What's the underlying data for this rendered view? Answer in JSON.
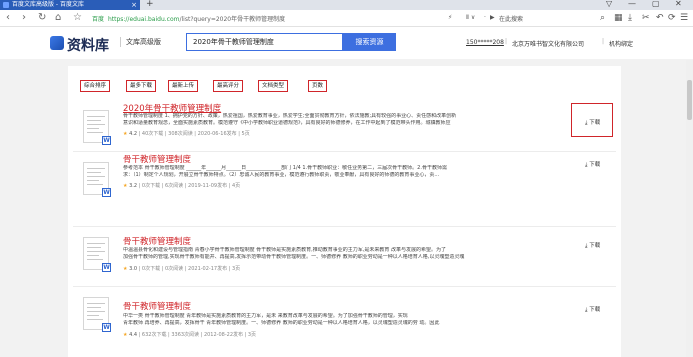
{
  "browser": {
    "tab_title": "百度文库高级版 - 百度文库",
    "tab_close": "×",
    "tab_add": "+",
    "window_controls": [
      "▽",
      "—",
      "▢",
      "✕"
    ],
    "nav": [
      "‹",
      "›",
      "↻",
      "⌂",
      "☆"
    ],
    "security": "百度",
    "url_host": "https://eduai.baidu.com",
    "url_path": "/list?query=2020年骨干教师管理制度",
    "address_right": [
      "⚡",
      "Ⅱ ∨",
      "·",
      "▶",
      "在此搜索"
    ],
    "toolbar_icons": [
      "⌕",
      "▦",
      "⤓",
      "✂",
      "↶",
      "⟳",
      "☰"
    ]
  },
  "header": {
    "logo_text": "资料库",
    "subtitle": "文库高级版",
    "search_value": "2020年骨干教师管理制度",
    "search_button": "搜索资源",
    "user": "150*****208",
    "org": "北京万唯书智文化有限公司",
    "org_bind": "机构绑定"
  },
  "filters": [
    "综合排序",
    "最多下载",
    "最新上传",
    "最高评分",
    "文档类型",
    "页数"
  ],
  "results": [
    {
      "title": "2020年骨干教师管理制度",
      "snippet1": "骨干教师管理制度 1、拥护党的方针、政策，热爱祖国，热爱教育事业，热爱学生;全面贯彻教育方针，依法施教;具有较强的事业心、责任感和改革创新",
      "snippet2": "意识和适量教育观念，全面实施素质教育。模范遵守《中小学教师职业道德规范》，具有良好的师德修养，在工作中起到了模范带头作用。城镇教师应",
      "score": "4.2",
      "downloads": "40次下载",
      "views": "308次阅读",
      "date": "2020-06-16发布",
      "pages": "5页",
      "download": "下载"
    },
    {
      "title": "骨干教师管理制度",
      "snippet1": "参考范本 骨干教师管理制度 ______年______月______日______________部门 1/4 1.骨干教师职业：敏任业务第二，三届次骨干教师。2.骨干教师需",
      "snippet2": "求：（1）制定个人规划，开展立骨干教师特点。（2）忠诚人民的教育事业，模范遵行教师职责，敬业奉献，具有良好的师德的教育事业心，责...",
      "score": "3.2",
      "downloads": "0次下载",
      "views": "6次阅读",
      "date": "2019-11-09发布",
      "pages": "4页",
      "download": "下载"
    },
    {
      "title": "骨干教师管理制度",
      "snippet1": "中温温县骨化和建设与管理指南 青春小学骨干教师管理制度 骨干教师是实施素质教育,推动教育事业的主力军,是未来教育 改革与发展的希望。为了",
      "snippet2": "加强骨干教师的管理,实现骨干教师有能并、再提高,发挥示范带动骨干教师管理制度。一、师德修养 教师的职业劳动是一种以人格培育人格,以灵魂塑造灵魂",
      "score": "3.0",
      "downloads": "0次下载",
      "views": "0次阅读",
      "date": "2021-02-17发布",
      "pages": "3页",
      "download": "下载"
    },
    {
      "title": "骨干教师管理制度",
      "snippet1": "中华一类 骨干教师管理制度 青年教师是实施素质教育的主力军，是未 来教育改革与发展的希望。为了加强骨干教师的管理，实现",
      "snippet2": "青年教师 再培养、再提高，发挥骨干 青年教师管理制度。一、师德修养 教师的职业劳动是一种以人格培育人格，以灵魂塑造灵魂的劳 动。因此",
      "score": "4.4",
      "downloads": "632次下载",
      "views": "3363次阅读",
      "date": "2012-08-22发布",
      "pages": "3页",
      "download": "下载"
    }
  ]
}
